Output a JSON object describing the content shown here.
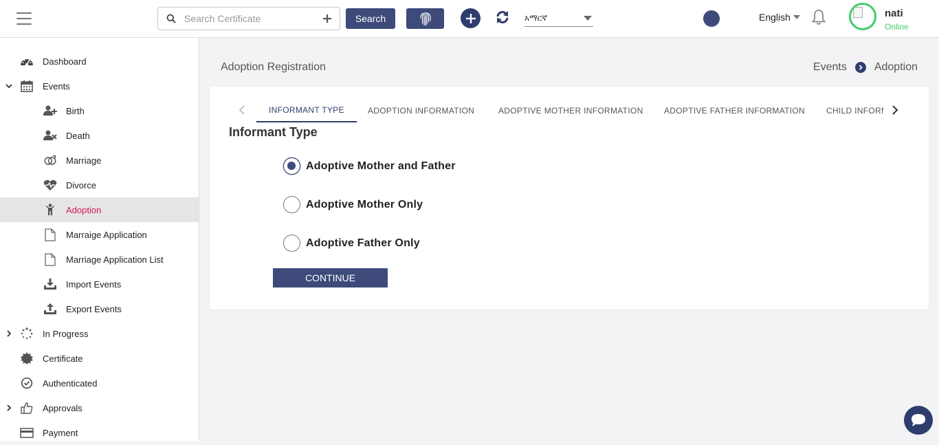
{
  "topbar": {
    "search_placeholder": "Search Certificate",
    "search_button": "Search",
    "language_select_value": "አማርኛ",
    "language_label": "English",
    "user_name": "nati",
    "user_status": "Online",
    "icons": [
      "hamburger-icon",
      "search-icon",
      "plus-icon",
      "fingerprint-icon",
      "add-circle-icon",
      "refresh-icon",
      "bell-icon",
      "avatar-image"
    ]
  },
  "sidebar": {
    "items": [
      {
        "label": "Dashboard",
        "icon": "dashboard-icon",
        "level": "top"
      },
      {
        "label": "Events",
        "icon": "calendar-icon",
        "level": "top",
        "expanded": true
      },
      {
        "label": "Birth",
        "icon": "user-plus-icon",
        "level": "sub"
      },
      {
        "label": "Death",
        "icon": "user-x-icon",
        "level": "sub"
      },
      {
        "label": "Marriage",
        "icon": "rings-icon",
        "level": "sub"
      },
      {
        "label": "Divorce",
        "icon": "broken-heart-icon",
        "level": "sub"
      },
      {
        "label": "Adoption",
        "icon": "child-icon",
        "level": "sub",
        "active": true
      },
      {
        "label": "Marraige Application",
        "icon": "document-icon",
        "level": "sub"
      },
      {
        "label": "Marriage Application List",
        "icon": "document-icon",
        "level": "sub"
      },
      {
        "label": "Import Events",
        "icon": "download-icon",
        "level": "sub"
      },
      {
        "label": "Export Events",
        "icon": "upload-icon",
        "level": "sub"
      },
      {
        "label": "In Progress",
        "icon": "spinner-icon",
        "level": "top",
        "collapsed": true
      },
      {
        "label": "Certificate",
        "icon": "certificate-icon",
        "level": "top"
      },
      {
        "label": "Authenticated",
        "icon": "check-circle-icon",
        "level": "top"
      },
      {
        "label": "Approvals",
        "icon": "thumbs-up-icon",
        "level": "top",
        "collapsed": true
      },
      {
        "label": "Payment",
        "icon": "card-icon",
        "level": "top"
      }
    ]
  },
  "main": {
    "page_title": "Adoption Registration",
    "breadcrumb": [
      "Events",
      "Adoption"
    ],
    "tabs": [
      {
        "label": "INFORMANT TYPE",
        "active": true
      },
      {
        "label": "ADOPTION INFORMATION"
      },
      {
        "label": "ADOPTIVE MOTHER INFORMATION"
      },
      {
        "label": "ADOPTIVE FATHER INFORMATION"
      },
      {
        "label": "CHILD INFORMATION"
      }
    ],
    "section_title": "Informant Type",
    "options": [
      {
        "label": "Adoptive Mother and Father",
        "checked": true
      },
      {
        "label": "Adoptive Mother Only",
        "checked": false
      },
      {
        "label": "Adoptive Father Only",
        "checked": false
      }
    ],
    "continue_button": "CONTINUE"
  },
  "colors": {
    "primary": "#3d4a7a",
    "active_nav_text": "#d6175b",
    "online": "#3fce6e"
  }
}
